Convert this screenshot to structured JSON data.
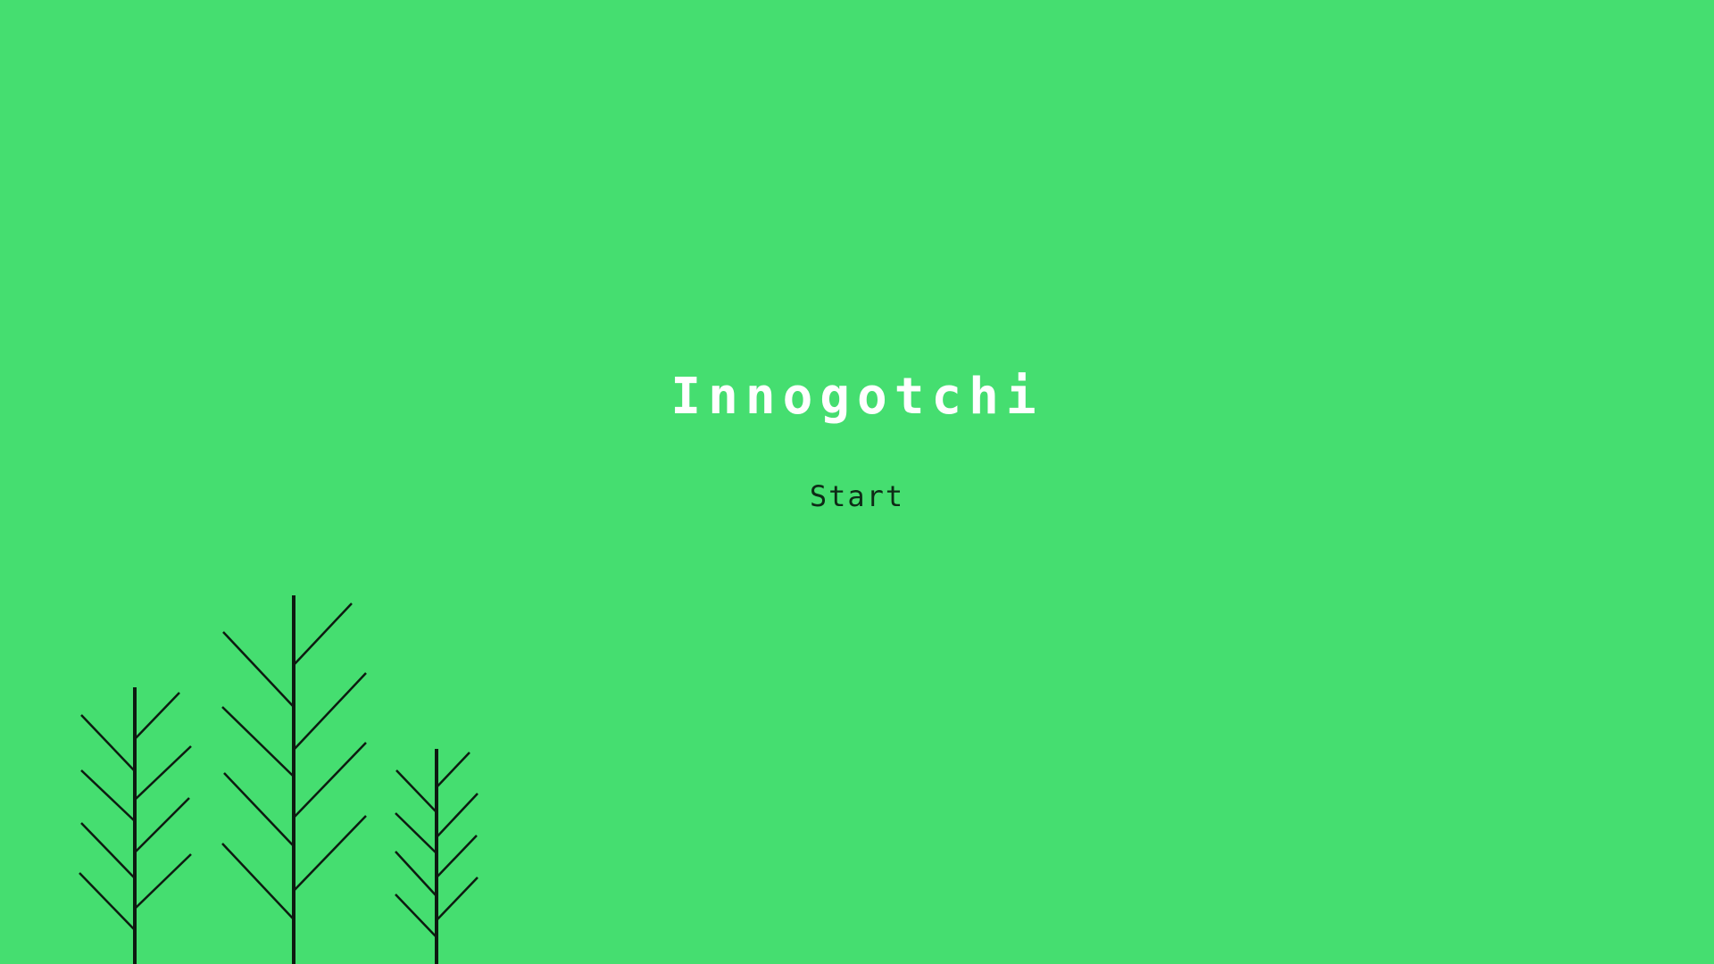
{
  "game": {
    "title": "Innogotchi",
    "start_label": "Start"
  },
  "colors": {
    "background": "#45de70",
    "title": "#ffffff",
    "start": "#0e2a16",
    "trees": "#0d1a10"
  }
}
